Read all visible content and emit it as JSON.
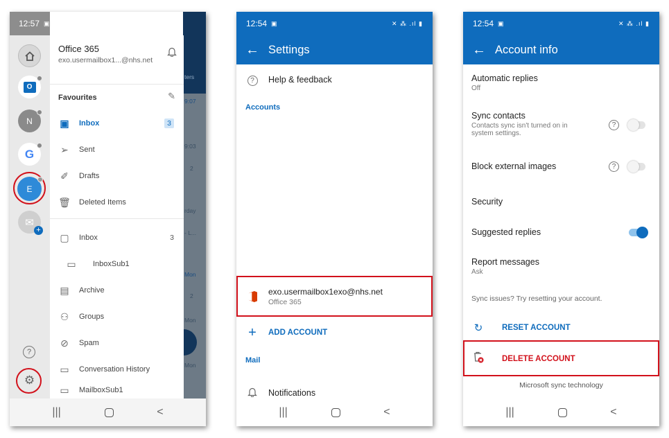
{
  "colors": {
    "brand_blue": "#0f6cbd",
    "highlight_red": "#d2111b"
  },
  "status": {
    "time_1": "12:57",
    "time_2": "12:54",
    "time_3": "12:54"
  },
  "nav": {
    "recents": "|||",
    "back": "<"
  },
  "phone1": {
    "rail": [
      {
        "name": "home",
        "icon": "home-icon"
      },
      {
        "name": "outlook",
        "icon": "outlook-icon"
      },
      {
        "name": "account-n",
        "letter": "N"
      },
      {
        "name": "google",
        "letter": "G"
      },
      {
        "name": "account-e",
        "letter": "E"
      },
      {
        "name": "add-account",
        "icon": "mail-add-icon"
      }
    ],
    "account_title": "Office 365",
    "account_email": "exo.usermailbox1...@nhs.net",
    "favourites_label": "Favourites",
    "items": [
      {
        "label": "Inbox",
        "count": "3",
        "icon": "inbox-icon",
        "active": true
      },
      {
        "label": "Sent",
        "count": "",
        "icon": "send-icon"
      },
      {
        "label": "Drafts",
        "count": "",
        "icon": "drafts-icon"
      },
      {
        "label": "Deleted Items",
        "count": "",
        "icon": "trash-icon"
      },
      {
        "label": "Inbox",
        "count": "3",
        "icon": "inbox-icon"
      },
      {
        "label": "InboxSub1",
        "count": "",
        "icon": "folder-icon"
      },
      {
        "label": "Archive",
        "count": "",
        "icon": "archive-icon"
      },
      {
        "label": "Groups",
        "count": "",
        "icon": "groups-icon"
      },
      {
        "label": "Spam",
        "count": "",
        "icon": "spam-folder-icon"
      },
      {
        "label": "Conversation History",
        "count": "",
        "icon": "folder-icon"
      },
      {
        "label": "MailboxSub1",
        "count": "",
        "icon": "folder-icon"
      }
    ],
    "backdrop": {
      "t1": "ters",
      "t2": "9:07",
      "t3": "9:03",
      "t4": "2",
      "t5": "rday",
      "t6": "- L...",
      "t7": "Mon",
      "t8": "2",
      "t9": "Mon",
      "t10": "Mon"
    }
  },
  "phone2": {
    "title": "Settings",
    "help_label": "Help & feedback",
    "accounts_header": "Accounts",
    "account_email": "exo.usermailbox1exo@nhs.net",
    "account_type": "Office 365",
    "add_account": "ADD ACCOUNT",
    "mail_header": "Mail",
    "notifications": "Notifications"
  },
  "phone3": {
    "title": "Account info",
    "auto_replies": {
      "label": "Automatic replies",
      "value": "Off"
    },
    "sync_contacts": {
      "label": "Sync contacts",
      "desc_1": "Contacts sync isn't turned on in",
      "desc_2": "system settings.",
      "on": false
    },
    "block_images": {
      "label": "Block external images",
      "on": false
    },
    "security": "Security",
    "suggested_replies": {
      "label": "Suggested replies",
      "on": true
    },
    "report_messages": {
      "label": "Report messages",
      "value": "Ask"
    },
    "sync_issue_text": "Sync issues? Try resetting your account.",
    "reset_account": "RESET ACCOUNT",
    "delete_account": "DELETE ACCOUNT",
    "footer": "Microsoft sync technology"
  }
}
